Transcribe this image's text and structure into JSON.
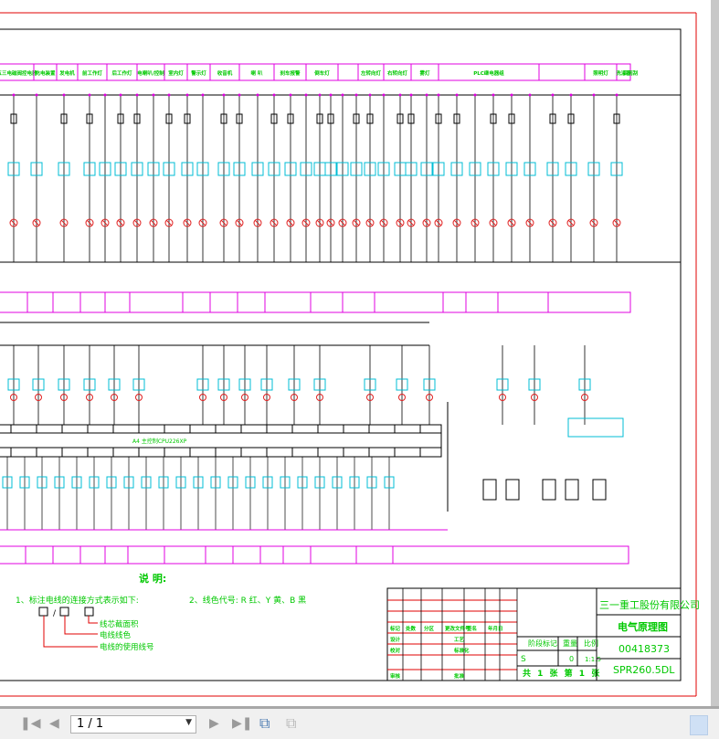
{
  "drawing": {
    "header_labels": [
      "五三电磁阀控电器",
      "充电装置",
      "发电机",
      "前工作灯",
      "后工作灯",
      "电喇叭/控制",
      "室内灯",
      "警示灯",
      "收音机",
      "喇 叭",
      "刹车报警",
      "倒车灯",
      "",
      "左转向灯",
      "右转向灯",
      "雾灯",
      "PLC继电器组",
      "",
      "照明灯",
      "洗涤器",
      "后雨刮"
    ],
    "controller_label": "A4 主控制CPU226XP",
    "notes": {
      "title": "说 明:",
      "note1": "1、标注电线的连接方式表示如下:",
      "note2": "2、线色代号: R 红、Y 黄、B 黑",
      "format_sep": "/",
      "legend_core": "线芯截面积",
      "legend_color": "电线线色",
      "legend_number": "电线的使用线号"
    },
    "title_block": {
      "company": "三一重工股份有限公司",
      "drawing_title": "电气原理图",
      "drawing_number": "00418373",
      "model": "SPR260.5DL",
      "headers": [
        "标记",
        "处数",
        "分区",
        "更改文件号",
        "签名",
        "年月日"
      ],
      "roles": [
        "设计",
        "校对",
        "",
        "审核"
      ],
      "roles2": [
        "工艺",
        "标准化",
        "",
        "批准"
      ],
      "stage_label": "阶段标记",
      "weight_label": "重量",
      "scale_label": "比例",
      "stage_value": "S",
      "weight_value": "0",
      "scale_value": "1:1.5",
      "sheet_info": "共 1 张 第 1 张"
    },
    "colors": {
      "wire": "#000000",
      "label": "#00c800",
      "box": "#e000e0",
      "component": "#00bcd4",
      "lamp": "#e02020",
      "border": "#e00000"
    }
  },
  "toolbar": {
    "first_page_icon": "first-page-icon",
    "prev_page_icon": "prev-page-icon",
    "page_value": "1 / 1",
    "next_page_icon": "next-page-icon",
    "last_page_icon": "last-page-icon"
  }
}
